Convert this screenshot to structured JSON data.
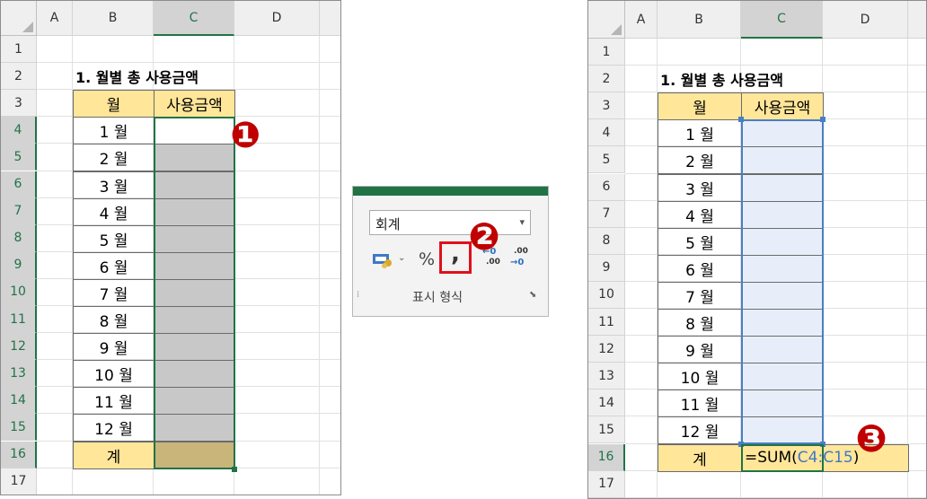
{
  "columns": [
    "A",
    "B",
    "C",
    "D"
  ],
  "rows": [
    "1",
    "2",
    "3",
    "4",
    "5",
    "6",
    "7",
    "8",
    "9",
    "10",
    "11",
    "12",
    "13",
    "14",
    "15",
    "16",
    "17"
  ],
  "table": {
    "title": "1. 월별 총 사용금액",
    "header_month": "월",
    "header_amount": "사용금액",
    "months": [
      "1 월",
      "2 월",
      "3 월",
      "4 월",
      "5 월",
      "6 월",
      "7 월",
      "8 월",
      "9 월",
      "10 월",
      "11 월",
      "12 월"
    ],
    "total_label": "계"
  },
  "ribbon": {
    "format_dropdown": "회계",
    "percent_label": "%",
    "comma_label": ",",
    "increase_decimal_label": ".00",
    "decrease_decimal_label": ".00",
    "group_label": "표시 형식"
  },
  "formula": {
    "prefix": "=SUM(",
    "range": "C4:C15",
    "suffix": ")"
  },
  "markers": [
    "❶",
    "❷",
    "❸"
  ],
  "colors": {
    "header_fill": "#ffe699",
    "selected_gray": "#c8c8c8",
    "total_fill": "#c9b47a",
    "selection_blue_fill": "#e8eef9",
    "selection_blue_border": "#4a7ec4",
    "marker_red": "#c00000",
    "excel_green": "#217346"
  }
}
